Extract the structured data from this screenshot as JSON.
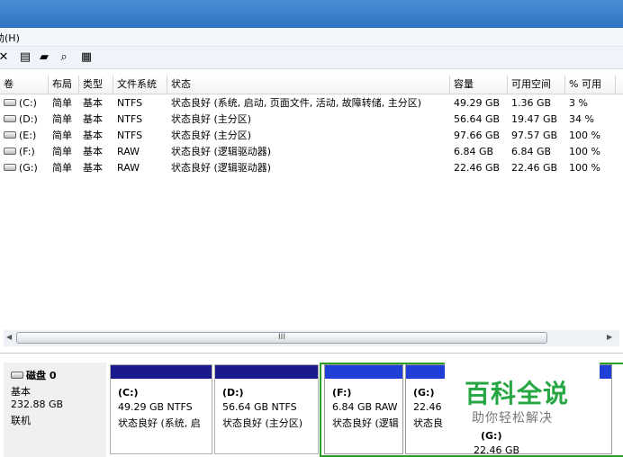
{
  "menu": {
    "help": "助(H)"
  },
  "toolbar": {
    "icons": [
      "close-icon",
      "properties-icon",
      "open-folder-icon",
      "search-icon",
      "disk-icon"
    ]
  },
  "table": {
    "headers": [
      "卷",
      "布局",
      "类型",
      "文件系统",
      "状态",
      "容量",
      "可用空间",
      "% 可用"
    ],
    "rows": [
      {
        "vol": "(C:)",
        "layout": "简单",
        "type": "基本",
        "fs": "NTFS",
        "status": "状态良好 (系统, 启动, 页面文件, 活动, 故障转储, 主分区)",
        "cap": "49.29 GB",
        "free": "1.36 GB",
        "pct": "3 %"
      },
      {
        "vol": "(D:)",
        "layout": "简单",
        "type": "基本",
        "fs": "NTFS",
        "status": "状态良好 (主分区)",
        "cap": "56.64 GB",
        "free": "19.47 GB",
        "pct": "34 %"
      },
      {
        "vol": "(E:)",
        "layout": "简单",
        "type": "基本",
        "fs": "NTFS",
        "status": "状态良好 (主分区)",
        "cap": "97.66 GB",
        "free": "97.57 GB",
        "pct": "100 %"
      },
      {
        "vol": "(F:)",
        "layout": "简单",
        "type": "基本",
        "fs": "RAW",
        "status": "状态良好 (逻辑驱动器)",
        "cap": "6.84 GB",
        "free": "6.84 GB",
        "pct": "100 %"
      },
      {
        "vol": "(G:)",
        "layout": "简单",
        "type": "基本",
        "fs": "RAW",
        "status": "状态良好 (逻辑驱动器)",
        "cap": "22.46 GB",
        "free": "22.46 GB",
        "pct": "100 %"
      }
    ]
  },
  "scrollbar": {
    "thumb_grip": "III"
  },
  "disk": {
    "name": "磁盘 0",
    "type": "基本",
    "size": "232.88 GB",
    "status": "联机",
    "partitions": [
      {
        "label": "(C:)",
        "size": "49.29 GB NTFS",
        "status": "状态良好 (系统, 启"
      },
      {
        "label": "(D:)",
        "size": "56.64 GB NTFS",
        "status": "状态良好 (主分区)"
      },
      {
        "label": "(F:)",
        "size": "6.84 GB RAW",
        "status": "状态良好 (逻辑"
      },
      {
        "label": "(G:)",
        "size": "22.46 (",
        "status": "状态良"
      }
    ],
    "overflow_label": "(G:)",
    "overflow_size": "22.46 GB"
  },
  "watermark": {
    "title": "百科全说",
    "subtitle": "助你轻松解决"
  },
  "colors": {
    "primary_bar": "#1a1a8c",
    "logical_bar": "#1f3fd6",
    "extended_border": "#2aa02a",
    "titlebar": "#3a80cc",
    "watermark_green": "#27a744"
  }
}
